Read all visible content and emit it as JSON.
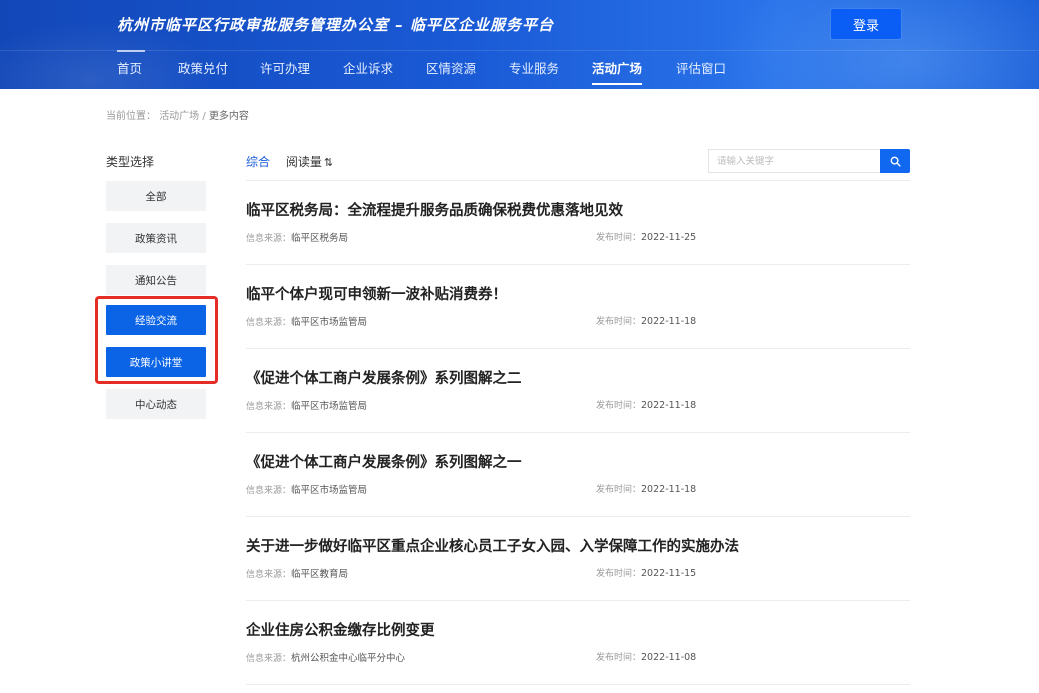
{
  "header": {
    "title": "杭州市临平区行政审批服务管理办公室 – 临平区企业服务平台",
    "login_label": "登录"
  },
  "nav": {
    "items": [
      "首页",
      "政策兑付",
      "许可办理",
      "企业诉求",
      "区情资源",
      "专业服务",
      "活动广场",
      "评估窗口"
    ],
    "active_index": 6
  },
  "breadcrumb": {
    "prefix": "当前位置：",
    "items": [
      "活动广场",
      "更多内容"
    ],
    "separator": " / "
  },
  "sidebar": {
    "title": "类型选择",
    "categories": [
      "全部",
      "政策资讯",
      "通知公告",
      "经验交流",
      "政策小讲堂",
      "中心动态"
    ],
    "selected": [
      "经验交流",
      "政策小讲堂"
    ]
  },
  "sort": {
    "tabs": [
      "综合",
      "阅读量"
    ],
    "sort_icon": "⇅"
  },
  "search": {
    "placeholder": "请输入关键字",
    "button_icon": "search-icon"
  },
  "meta_labels": {
    "source": "信息来源：",
    "date": "发布时间："
  },
  "articles": [
    {
      "title": "临平区税务局：全流程提升服务品质确保税费优惠落地见效",
      "source": "临平区税务局",
      "date": "2022-11-25"
    },
    {
      "title": "临平个体户现可申领新一波补贴消费券！",
      "source": "临平区市场监管局",
      "date": "2022-11-18"
    },
    {
      "title": "《促进个体工商户发展条例》系列图解之二",
      "source": "临平区市场监管局",
      "date": "2022-11-18"
    },
    {
      "title": "《促进个体工商户发展条例》系列图解之一",
      "source": "临平区市场监管局",
      "date": "2022-11-18"
    },
    {
      "title": "关于进一步做好临平区重点企业核心员工子女入园、入学保障工作的实施办法",
      "source": "临平区教育局",
      "date": "2022-11-15"
    },
    {
      "title": "企业住房公积金缴存比例变更",
      "source": "杭州公积金中心临平分中心",
      "date": "2022-11-08"
    }
  ],
  "colors": {
    "header_bg": "#1a5ad6",
    "primary": "#0b63e6",
    "highlight": "#e52d27"
  }
}
